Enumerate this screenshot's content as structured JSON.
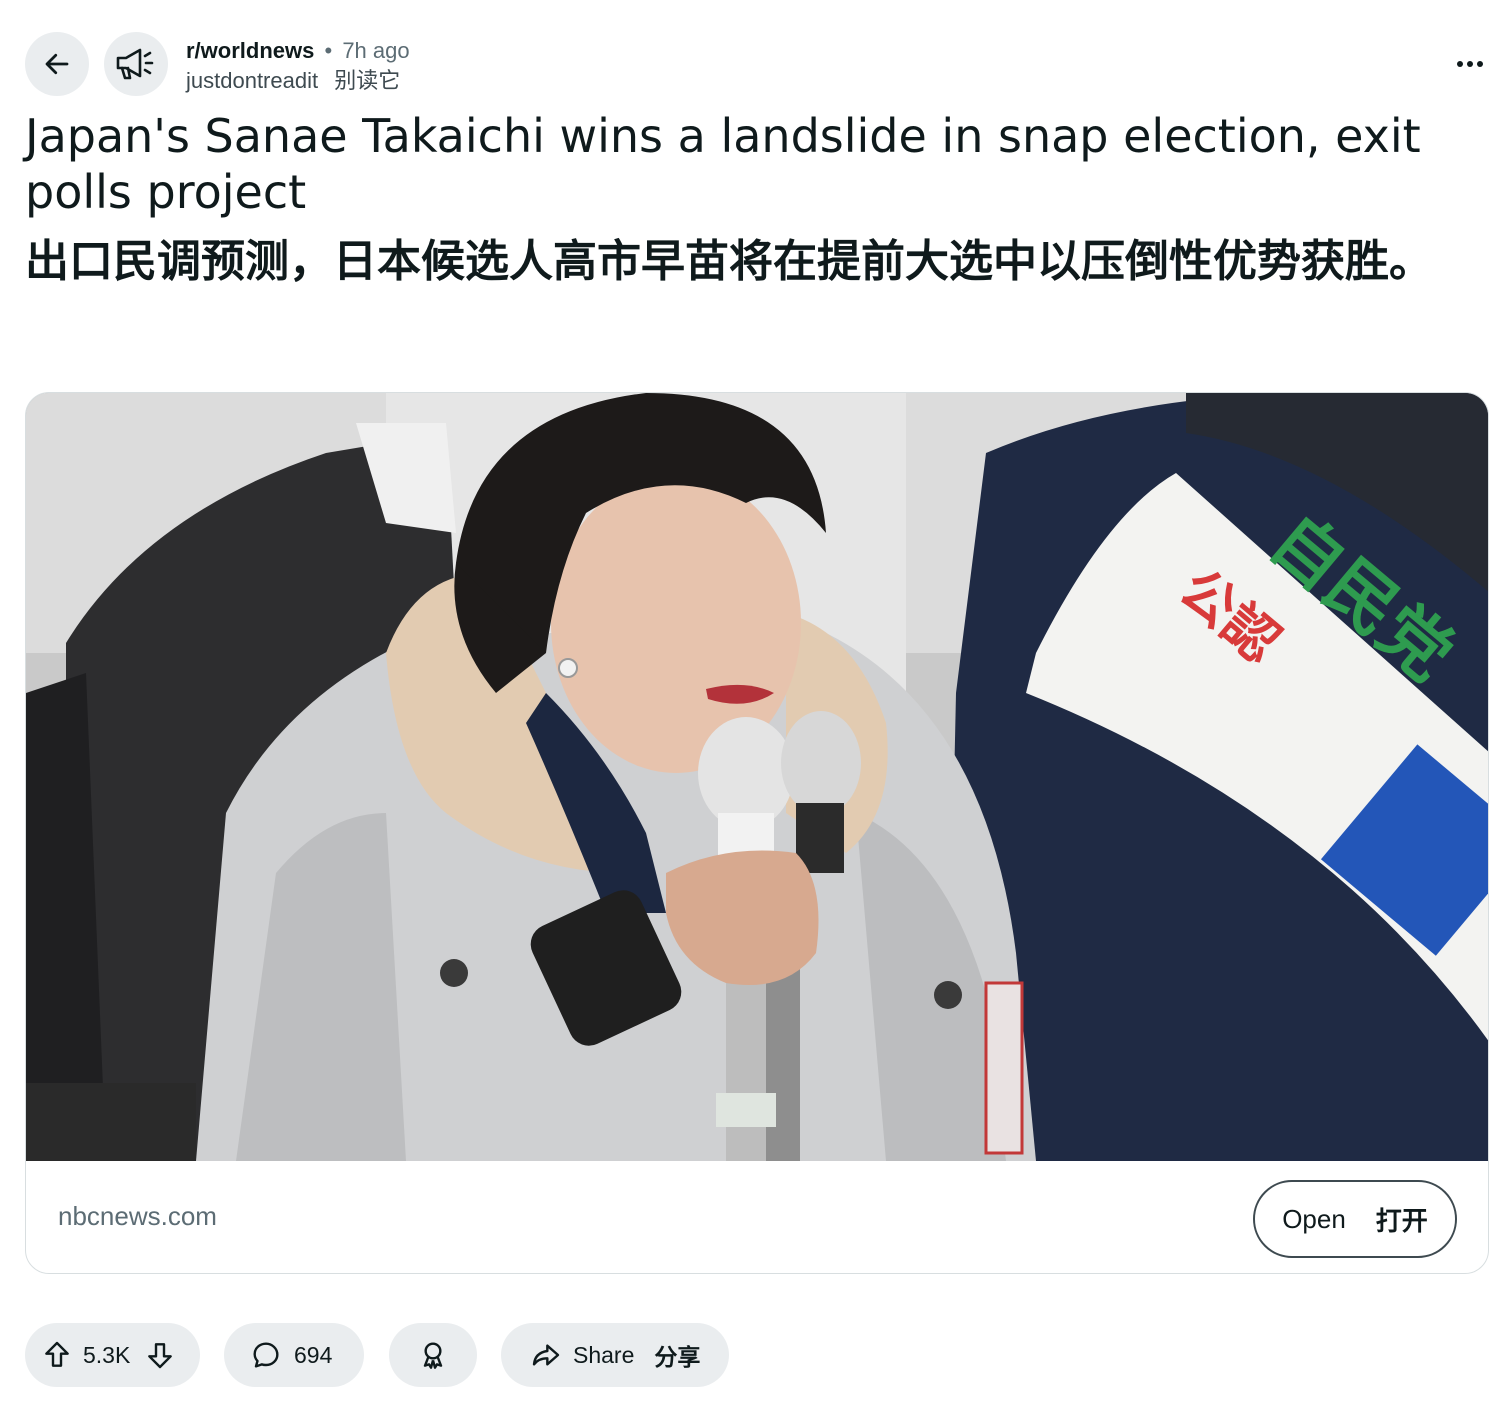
{
  "header": {
    "back_icon": "arrow-left-icon",
    "subreddit_icon": "megaphone-icon",
    "subreddit": "r/worldnews",
    "separator": "•",
    "age": "7h ago",
    "username": "justdontreadit",
    "username_translation": "别读它",
    "more_icon": "more-horizontal-icon"
  },
  "post": {
    "title": "Japan's Sanae Takaichi wins a landslide in snap election, exit polls project",
    "title_translation": "出口民调预测，日本候选人高市早苗将在提前大选中以压倒性优势获胜。"
  },
  "link_card": {
    "domain": "nbcnews.com",
    "open_label": "Open",
    "open_translation": "打开",
    "image_sash_text": "自民党",
    "image_sash_text_secondary": "公認"
  },
  "actions": {
    "upvote_icon": "arrow-up-icon",
    "vote_count": "5.3K",
    "downvote_icon": "arrow-down-icon",
    "comment_icon": "speech-bubble-icon",
    "comment_count": "694",
    "award_icon": "award-icon",
    "share_icon": "share-arrow-icon",
    "share_label": "Share",
    "share_translation": "分享"
  },
  "colors": {
    "pill_background": "#eaedef",
    "text_primary": "#0f1a1c",
    "text_secondary": "#5c6c74",
    "card_border": "#d8dee0",
    "sash_green": "#2e9b4f",
    "sash_red": "#d83a3a",
    "sash_blue": "#2356b8"
  }
}
